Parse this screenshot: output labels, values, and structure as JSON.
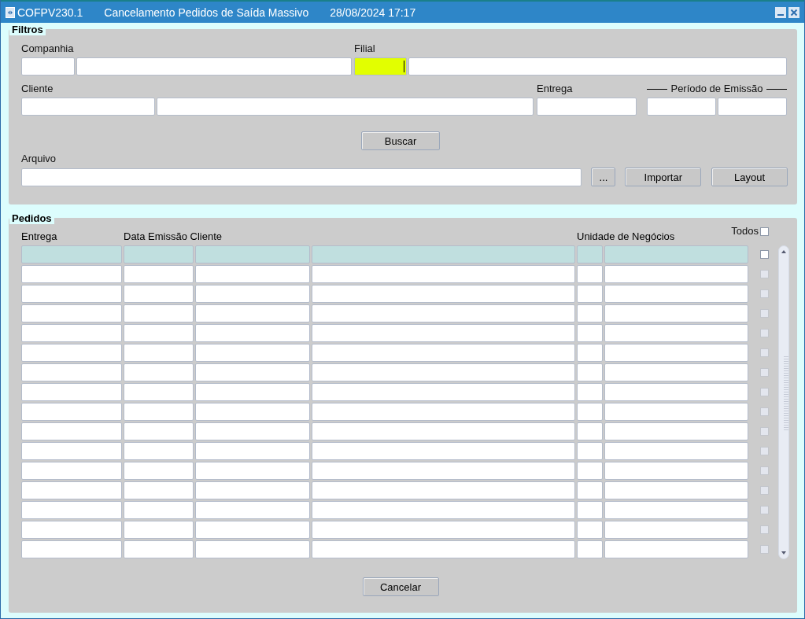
{
  "window": {
    "code": "COFPV230.1",
    "title": "Cancelamento Pedidos de Saída Massivo",
    "datetime": "28/08/2024 17:17"
  },
  "filters": {
    "title": "Filtros",
    "companhia": {
      "label": "Companhia",
      "fields": [
        {
          "focused": false
        },
        {
          "focused": false
        }
      ]
    },
    "filial": {
      "label": "Filial",
      "fields": [
        {
          "focused": true
        },
        {
          "focused": false
        }
      ]
    },
    "cliente": {
      "label": "Cliente",
      "fields": [
        {
          "focused": false
        },
        {
          "focused": false
        }
      ]
    },
    "entrega": {
      "label": "Entrega",
      "fields": [
        {
          "focused": false
        }
      ]
    },
    "periodo": {
      "label": "Período de Emissão",
      "fields": [
        {
          "focused": false
        },
        {
          "focused": false
        }
      ]
    },
    "search_button": "Buscar",
    "arquivo": {
      "label": "Arquivo",
      "fields": [
        {
          "focused": false
        }
      ]
    },
    "browse_button": "...",
    "import_button": "Importar",
    "layout_button": "Layout"
  },
  "pedidos": {
    "title": "Pedidos",
    "headers": [
      "Entrega",
      "Data Emissão Cliente",
      "Unidade de Negócios"
    ],
    "select_all": {
      "label": "Todos",
      "checked": false
    },
    "rows": [
      {
        "selected": true,
        "checked": false,
        "disabled": false
      },
      {
        "selected": false,
        "checked": false,
        "disabled": true
      },
      {
        "selected": false,
        "checked": false,
        "disabled": true
      },
      {
        "selected": false,
        "checked": false,
        "disabled": true
      },
      {
        "selected": false,
        "checked": false,
        "disabled": true
      },
      {
        "selected": false,
        "checked": false,
        "disabled": true
      },
      {
        "selected": false,
        "checked": false,
        "disabled": true
      },
      {
        "selected": false,
        "checked": false,
        "disabled": true
      },
      {
        "selected": false,
        "checked": false,
        "disabled": true
      },
      {
        "selected": false,
        "checked": false,
        "disabled": true
      },
      {
        "selected": false,
        "checked": false,
        "disabled": true
      },
      {
        "selected": false,
        "checked": false,
        "disabled": true
      },
      {
        "selected": false,
        "checked": false,
        "disabled": true
      },
      {
        "selected": false,
        "checked": false,
        "disabled": true
      },
      {
        "selected": false,
        "checked": false,
        "disabled": true
      },
      {
        "selected": false,
        "checked": false,
        "disabled": true
      }
    ],
    "cancel_button": "Cancelar"
  }
}
